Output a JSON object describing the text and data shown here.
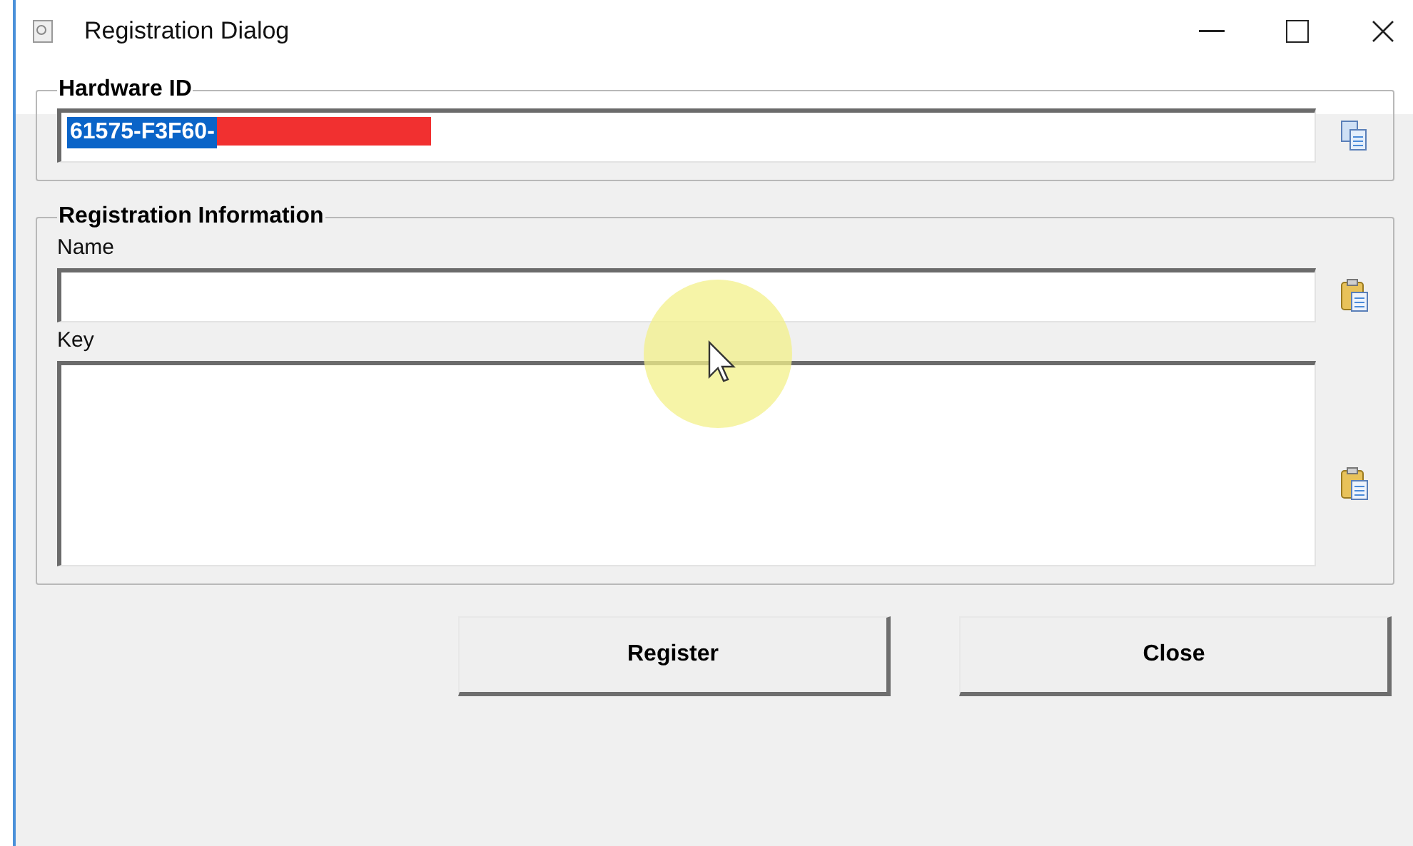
{
  "window": {
    "title": "Registration Dialog"
  },
  "hardware_id": {
    "label": "Hardware ID",
    "value": "61575-F3F60-",
    "selected": true,
    "redacted": true
  },
  "registration": {
    "label": "Registration Information",
    "fields": [
      {
        "label": "Name",
        "kind": "line"
      },
      {
        "label": "Key",
        "kind": "area"
      }
    ]
  },
  "buttons": [
    "Register",
    "Close"
  ]
}
